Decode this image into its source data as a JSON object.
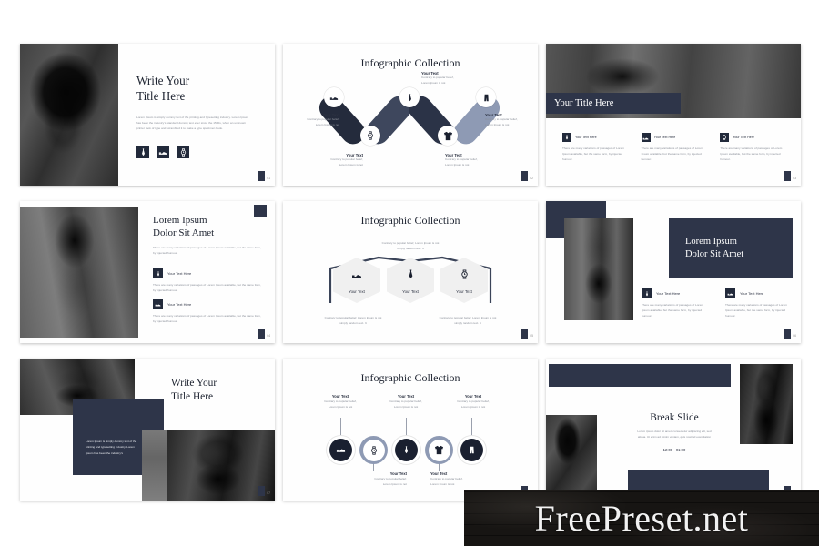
{
  "meta": {
    "watermark": "FreePreset.net",
    "accent_navy": "#2e3549",
    "accent_slate": "#5c6880",
    "accent_light_slate": "#8e9ab4",
    "background": "#ffffff"
  },
  "common": {
    "body_paragraph": "There are many variations of passages of Lorem Ipsum available, but the same form, by injected humour.",
    "lorem_paragraph": "Lorem Ipsum is simply dummy text of the printing and typesetting industry. Lorem Ipsum has been the industry's standard dummy text ever since the 1500s, when an unknown printer took of type and scrambled it to make a type specimen book.",
    "your_text_here": "Your Text Here",
    "your_text": "Your Text",
    "contrary_line1": "Contrary to popular belief,",
    "contrary_line2": "Lorem Ipsum is not",
    "contrary_long_1": "Contrary to popular belief, Lorem Ipsum is not",
    "contrary_long_2": "simply random text. It"
  },
  "slides": [
    {
      "index": 1,
      "page_number": "01",
      "title_line1": "Write Your",
      "title_line2": "Title Here",
      "paragraph": "Lorem Ipsum is simply dummy text of the printing and typesetting industry. Lorem Ipsum has been the industry's standard dummy text ever since the 1500s, when an unknown printer took of type and scrambled it to make a type specimen book.",
      "icons": [
        "tie-icon",
        "shoe-icon",
        "watch-icon"
      ]
    },
    {
      "index": 2,
      "page_number": "02",
      "title": "Infographic Collection",
      "nodes": [
        {
          "icon": "shoe-icon",
          "label": "Your Text",
          "line1": "Contrary to popular belief,",
          "line2": "Lorem Ipsum is not"
        },
        {
          "icon": "watch-icon",
          "label": "Your Text",
          "line1": "Contrary to popular belief,",
          "line2": "Lorem Ipsum is not"
        },
        {
          "icon": "tie-icon",
          "label": "Your Text",
          "line1": "Contrary to popular belief,",
          "line2": "Lorem Ipsum is not"
        },
        {
          "icon": "tshirt-icon",
          "label": "Your Text",
          "line1": "Contrary to popular belief,",
          "line2": "Lorem Ipsum is not"
        },
        {
          "icon": "pants-icon",
          "label": "Your Text",
          "line1": "Contrary to popular belief,",
          "line2": "Lorem Ipsum is not"
        }
      ]
    },
    {
      "index": 3,
      "page_number": "03",
      "title": "Your Title Here",
      "columns": [
        {
          "icon": "tie-icon",
          "heading": "Your Text Here",
          "body": "There are many variations of passages of Lorem Ipsum available, but the same form, by injected humour."
        },
        {
          "icon": "shoe-icon",
          "heading": "Your Text Here",
          "body": "There are many variations of passages of Lorem Ipsum available, but the same form, by injected humour."
        },
        {
          "icon": "watch-icon",
          "heading": "Your Text Here",
          "body": "There are many variations of passages of Lorem Ipsum available, but the same form, by injected humour."
        }
      ]
    },
    {
      "index": 4,
      "page_number": "04",
      "title_line1": "Lorem Ipsum",
      "title_line2": "Dolor Sit Amet",
      "intro": "There are many variations of passages of Lorem Ipsum available, but the same form, by injected humour.",
      "items": [
        {
          "icon": "tie-icon",
          "heading": "Your Text Here",
          "body": "There are many variations of passages of Lorem Ipsum available, but the same form, by injected humour."
        },
        {
          "icon": "shoe-icon",
          "heading": "Your Text Here",
          "body": "There are many variations of passages of Lorem Ipsum available, but the same form, by injected humour."
        }
      ]
    },
    {
      "index": 5,
      "page_number": "05",
      "title": "Infographic Collection",
      "top_caption_line1": "Contrary to popular belief, Lorem Ipsum is not",
      "top_caption_line2": "simply random text. It",
      "hexagons": [
        {
          "icon": "shoe-icon",
          "label": "Your Text"
        },
        {
          "icon": "tie-icon",
          "label": "Your Text"
        },
        {
          "icon": "watch-icon",
          "label": "Your Text"
        }
      ],
      "bottom_captions": [
        {
          "line1": "Contrary to popular belief, Lorem Ipsum is not",
          "line2": "simply random text. It"
        },
        {
          "line1": "Contrary to popular belief, Lorem Ipsum is not",
          "line2": "simply random text. It"
        }
      ]
    },
    {
      "index": 6,
      "page_number": "06",
      "title_line1": "Lorem Ipsum",
      "title_line2": "Dolor Sit Amet",
      "items": [
        {
          "icon": "tie-icon",
          "heading": "Your Text Here",
          "body": "There are many variations of passages of Lorem Ipsum available, but the same form, by injected humour."
        },
        {
          "icon": "shoe-icon",
          "heading": "Your Text Here",
          "body": "There are many variations of passages of Lorem Ipsum available, but the same form, by injected humour."
        }
      ]
    },
    {
      "index": 7,
      "page_number": "07",
      "title_line1": "Write Your",
      "title_line2": "Title Here",
      "caption": "Lorem Ipsum is simply dummy text of the printing and typesetting industry. Lorem Ipsum has been the industry's"
    },
    {
      "index": 8,
      "page_number": "08",
      "title": "Infographic Collection",
      "nodes": [
        {
          "icon": "shoe-icon",
          "label": "Your Text",
          "line1": "Contrary to popular belief,",
          "line2": "Lorem Ipsum is not",
          "position": "top"
        },
        {
          "icon": "watch-icon",
          "label": "Your Text",
          "line1": "Contrary to popular belief,",
          "line2": "Lorem Ipsum is not",
          "position": "bottom"
        },
        {
          "icon": "tie-icon",
          "label": "Your Text",
          "line1": "Contrary to popular belief,",
          "line2": "Lorem Ipsum is not",
          "position": "top"
        },
        {
          "icon": "tshirt-icon",
          "label": "Your Text",
          "line1": "Contrary to popular belief,",
          "line2": "Lorem Ipsum is not",
          "position": "bottom"
        },
        {
          "icon": "pants-icon",
          "label": "Your Text",
          "line1": "Contrary to popular belief,",
          "line2": "Lorem Ipsum is not",
          "position": "top"
        }
      ]
    },
    {
      "index": 9,
      "page_number": "09",
      "title": "Break Slide",
      "paragraph_line1": "Lorem ipsum dolor sit amet, consectetur adipiscing elit, sed",
      "paragraph_line2": "aliqua. Ut enim ad minim veniam, quis nostrud exercitation",
      "time": "12:00 - 01:00"
    }
  ]
}
